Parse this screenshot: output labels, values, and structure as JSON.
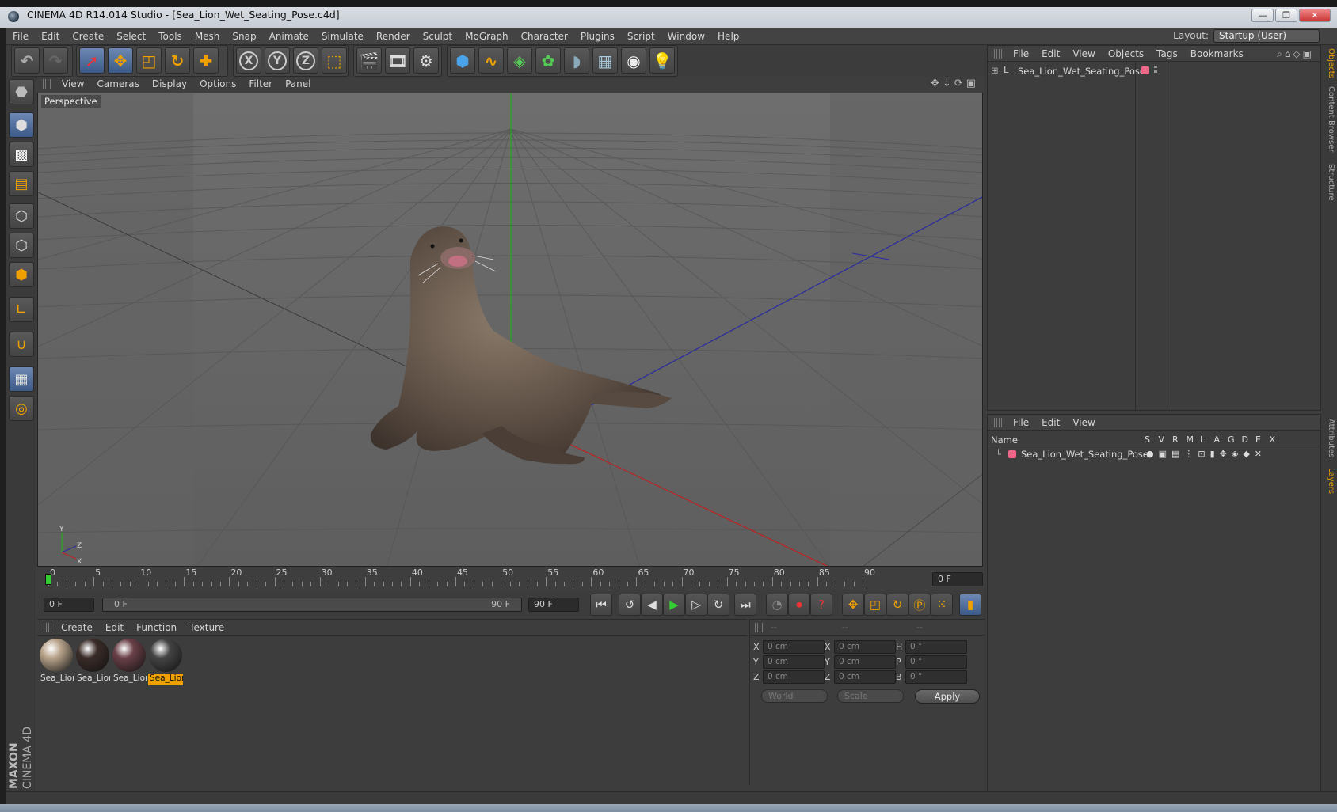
{
  "window": {
    "title": "CINEMA 4D R14.014 Studio - [Sea_Lion_Wet_Seating_Pose.c4d]",
    "minimize": "—",
    "maximize": "❐",
    "close": "✕"
  },
  "menubar": {
    "items": [
      "File",
      "Edit",
      "Create",
      "Select",
      "Tools",
      "Mesh",
      "Snap",
      "Animate",
      "Simulate",
      "Render",
      "Sculpt",
      "MoGraph",
      "Character",
      "Plugins",
      "Script",
      "Window",
      "Help"
    ],
    "layout_label": "Layout:",
    "layout_value": "Startup (User)"
  },
  "toolbar": {
    "icons": [
      "undo-icon",
      "redo-icon",
      "live-selection-icon",
      "move-icon",
      "scale-icon",
      "rotate-icon",
      "last-tool-icon",
      "x-axis-icon",
      "y-axis-icon",
      "z-axis-icon",
      "coordinate-system-icon",
      "render-view-icon",
      "render-picture-viewer-icon",
      "edit-render-settings-icon",
      "cube-icon",
      "spline-icon",
      "nurbs-icon",
      "array-icon",
      "deformer-icon",
      "floor-icon",
      "camera-icon",
      "light-icon"
    ],
    "axis_x": "X",
    "axis_y": "Y",
    "axis_z": "Z"
  },
  "viewport": {
    "menu": [
      "View",
      "Cameras",
      "Display",
      "Options",
      "Filter",
      "Panel"
    ],
    "label": "Perspective",
    "axis_y": "Y",
    "axis_z": "Z",
    "axis_x": "X"
  },
  "timeline": {
    "ticks": [
      "0",
      "5",
      "10",
      "15",
      "20",
      "25",
      "30",
      "35",
      "40",
      "45",
      "50",
      "55",
      "60",
      "65",
      "70",
      "75",
      "80",
      "85",
      "90"
    ],
    "current_frame": "0 F",
    "start_field": "0 F",
    "range_start": "0 F",
    "range_end": "90 F",
    "end_field": "90 F",
    "min_frame": 0,
    "max_frame": 90
  },
  "materials": {
    "menu": [
      "Create",
      "Edit",
      "Function",
      "Texture"
    ],
    "items": [
      {
        "name": "Sea_Lion",
        "color": "#b9a48b"
      },
      {
        "name": "Sea_Lion",
        "color": "#3a2c28"
      },
      {
        "name": "Sea_Lion",
        "color": "#6a4048"
      },
      {
        "name": "Sea_Lion",
        "color": "#444444"
      }
    ]
  },
  "coordinates": {
    "headers": [
      "--",
      "--",
      "--"
    ],
    "rows": [
      {
        "l1": "X",
        "v1": "0 cm",
        "l2": "X",
        "v2": "0 cm",
        "l3": "H",
        "v3": "0 °"
      },
      {
        "l1": "Y",
        "v1": "0 cm",
        "l2": "Y",
        "v2": "0 cm",
        "l3": "P",
        "v3": "0 °"
      },
      {
        "l1": "Z",
        "v1": "0 cm",
        "l2": "Z",
        "v2": "0 cm",
        "l3": "B",
        "v3": "0 °"
      }
    ],
    "mode": "World",
    "scale_mode": "Scale",
    "apply": "Apply"
  },
  "objects_panel": {
    "menu": [
      "File",
      "Edit",
      "View",
      "Objects",
      "Tags",
      "Bookmarks"
    ],
    "object_name": "Sea_Lion_Wet_Seating_Pose",
    "object_color": "#ee6688"
  },
  "layers_panel": {
    "menu": [
      "File",
      "Edit",
      "View"
    ],
    "columns": [
      "Name",
      "S",
      "V",
      "R",
      "M",
      "L",
      "A",
      "G",
      "D",
      "E",
      "X"
    ],
    "layer_name": "Sea_Lion_Wet_Seating_Pose",
    "layer_color": "#ee6688"
  },
  "side_tabs": [
    "Objects",
    "Content Browser",
    "Structure",
    "Attributes",
    "Layers"
  ],
  "branding": {
    "maxon": "MAXON",
    "product": "CINEMA 4D"
  },
  "colors": {
    "accent": "#f0a000",
    "active": "#4d6c9c"
  }
}
